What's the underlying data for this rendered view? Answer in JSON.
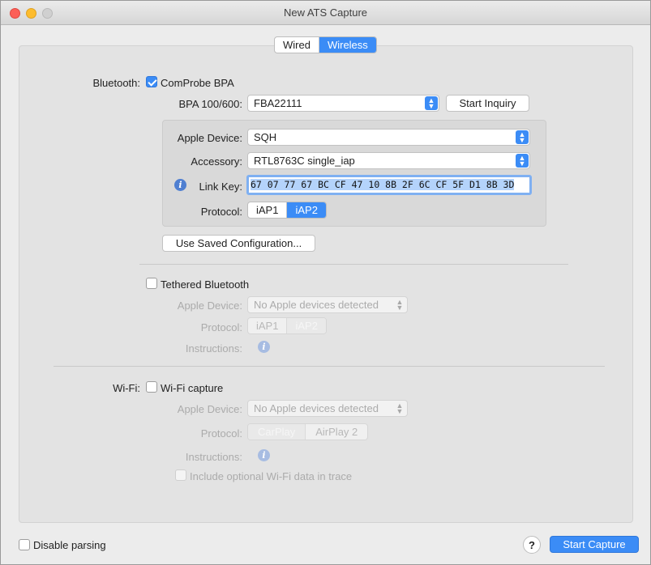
{
  "window": {
    "title": "New ATS Capture"
  },
  "mode_tabs": [
    {
      "label": "Wired",
      "selected": false
    },
    {
      "label": "Wireless",
      "selected": true
    }
  ],
  "bluetooth": {
    "section_label": "Bluetooth:",
    "comprobe_label": "ComProbe BPA",
    "comprobe_checked": true,
    "bpa_label": "BPA 100/600:",
    "bpa_value": "FBA22111",
    "start_inquiry_label": "Start Inquiry",
    "apple_device_label": "Apple Device:",
    "apple_device_value": "SQH",
    "accessory_label": "Accessory:",
    "accessory_value": "RTL8763C single_iap",
    "link_key_label": "Link Key:",
    "link_key_value": "67 07 77 67 BC CF 47 10 8B 2F 6C CF 5F D1 8B 3D",
    "protocol_label": "Protocol:",
    "protocol_options": [
      "iAP1",
      "iAP2"
    ],
    "protocol_selected": "iAP2",
    "use_saved_label": "Use Saved Configuration..."
  },
  "tethered": {
    "checkbox_label": "Tethered Bluetooth",
    "checked": false,
    "apple_device_label": "Apple Device:",
    "apple_device_value": "No Apple devices detected",
    "protocol_label": "Protocol:",
    "protocol_options": [
      "iAP1",
      "iAP2"
    ],
    "instructions_label": "Instructions:"
  },
  "wifi": {
    "section_label": "Wi-Fi:",
    "checkbox_label": "Wi-Fi capture",
    "checked": false,
    "apple_device_label": "Apple Device:",
    "apple_device_value": "No Apple devices detected",
    "protocol_label": "Protocol:",
    "protocol_options": [
      "CarPlay",
      "AirPlay 2"
    ],
    "instructions_label": "Instructions:",
    "optional_label": "Include optional Wi-Fi data in trace"
  },
  "footer": {
    "disable_parsing_label": "Disable parsing",
    "help_label": "?",
    "start_capture_label": "Start Capture"
  },
  "colors": {
    "accent": "#3b8cf6"
  },
  "icons": {
    "info": "info-icon",
    "popup_arrows": "chevron-updown-icon",
    "help": "help-icon"
  }
}
